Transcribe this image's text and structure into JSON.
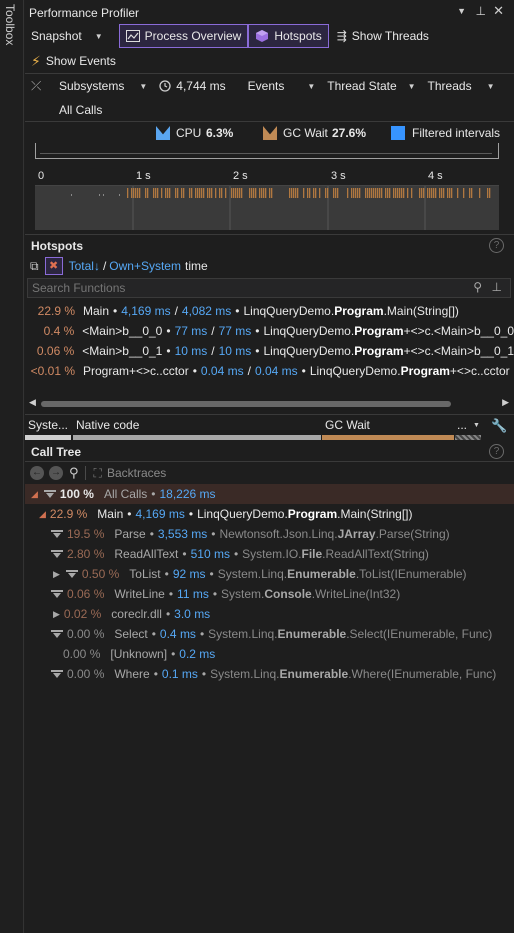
{
  "toolbox": {
    "label": "Toolbox"
  },
  "window": {
    "title": "Performance Profiler"
  },
  "toolbar": {
    "snapshot": "Snapshot",
    "process_overview": "Process Overview",
    "hotspots": "Hotspots",
    "show_threads": "Show Threads",
    "show_events": "Show Events"
  },
  "filters": {
    "subsystems": "Subsystems",
    "duration": "4,744 ms",
    "events": "Events",
    "thread_state": "Thread State",
    "threads": "Threads",
    "all_calls": "All Calls"
  },
  "legend": {
    "cpu_label": "CPU",
    "cpu_value": "6.3%",
    "gc_label": "GC Wait",
    "gc_value": "27.6%",
    "filtered": "Filtered intervals"
  },
  "timeline": {
    "ticks": [
      "0",
      "1 s",
      "2 s",
      "3 s",
      "4 s"
    ]
  },
  "hotspots": {
    "title": "Hotspots",
    "total": "Total",
    "own_system": "Own+System",
    "time_label": "time",
    "search_placeholder": "Search Functions",
    "rows": [
      {
        "pct": "22.9 %",
        "name": "Main",
        "t1": "4,169 ms",
        "t2": "4,082 ms",
        "ns": "LinqQueryDemo.",
        "cls": "Program",
        "rest": ".Main(String[])"
      },
      {
        "pct": "0.4 %",
        "name": "<Main>b__0_0",
        "t1": "77 ms",
        "t2": "77 ms",
        "ns": "LinqQueryDemo.",
        "cls": "Program",
        "rest": "+<>c.<Main>b__0_0"
      },
      {
        "pct": "0.06 %",
        "name": "<Main>b__0_1",
        "t1": "10 ms",
        "t2": "10 ms",
        "ns": "LinqQueryDemo.",
        "cls": "Program",
        "rest": "+<>c.<Main>b__0_1"
      },
      {
        "pct": "<0.01 %",
        "name": "Program+<>c..cctor",
        "t1": "0.04 ms",
        "t2": "0.04 ms",
        "ns": "LinqQueryDemo.",
        "cls": "Program",
        "rest": "+<>c..cctor"
      }
    ]
  },
  "subsys_bar": {
    "system": "Syste...",
    "native": "Native code",
    "gc": "GC Wait",
    "more": "..."
  },
  "calltree": {
    "title": "Call Tree",
    "backtraces": "Backtraces",
    "root": {
      "pct": "100 %",
      "name": "All Calls",
      "ms": "18,226 ms"
    },
    "main": {
      "pct": "22.9 %",
      "name": "Main",
      "ms": "4,169 ms",
      "ns": "LinqQueryDemo.",
      "cls": "Program",
      "rest": ".Main(String[])"
    },
    "rows": [
      {
        "pct": "19.5 %",
        "name": "Parse",
        "ms": "3,553 ms",
        "ns": "Newtonsoft.Json.Linq.",
        "cls": "JArray",
        "rest": ".Parse(String)"
      },
      {
        "pct": "2.80 %",
        "name": "ReadAllText",
        "ms": "510 ms",
        "ns": "System.IO.",
        "cls": "File",
        "rest": ".ReadAllText(String)"
      },
      {
        "pct": "0.50 %",
        "name": "ToList",
        "ms": "92 ms",
        "ns": "System.Linq.",
        "cls": "Enumerable",
        "rest": ".ToList(IEnumerable)"
      },
      {
        "pct": "0.06 %",
        "name": "WriteLine",
        "ms": "11 ms",
        "ns": "System.",
        "cls": "Console",
        "rest": ".WriteLine(Int32)"
      },
      {
        "pct": "0.02 %",
        "name": "coreclr.dll",
        "ms": "3.0 ms",
        "ns": "",
        "cls": "",
        "rest": ""
      },
      {
        "pct": "0.00 %",
        "name": "Select",
        "ms": "0.4 ms",
        "ns": "System.Linq.",
        "cls": "Enumerable",
        "rest": ".Select(IEnumerable, Func)"
      },
      {
        "pct": "0.00 %",
        "name": "[Unknown]",
        "ms": "0.2 ms",
        "ns": "",
        "cls": "",
        "rest": ""
      },
      {
        "pct": "0.00 %",
        "name": "Where",
        "ms": "0.1 ms",
        "ns": "System.Linq.",
        "cls": "Enumerable",
        "rest": ".Where(IEnumerable, Func)"
      }
    ]
  }
}
